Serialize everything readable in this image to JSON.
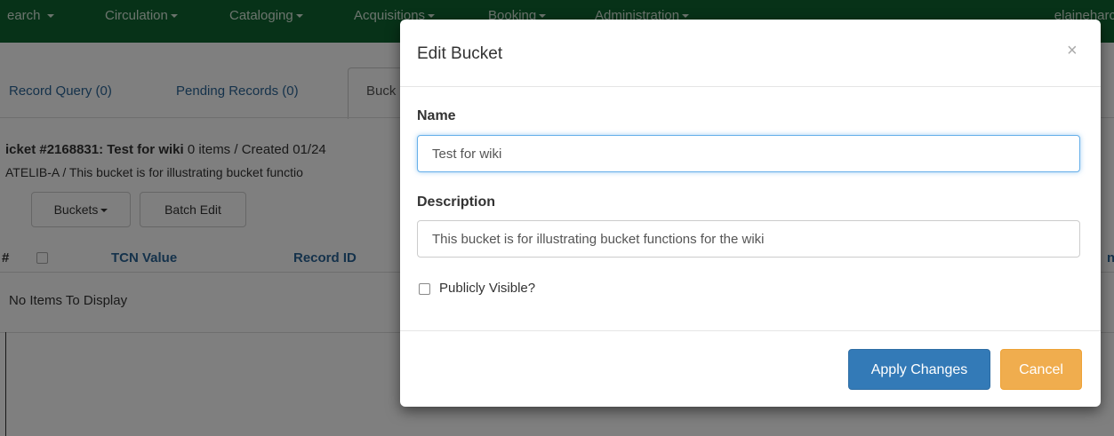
{
  "nav": {
    "items": [
      "earch",
      "Circulation",
      "Cataloging",
      "Acquisitions",
      "Booking",
      "Administration"
    ],
    "user": "elaineharc"
  },
  "page": {
    "tabs": [
      "Record Query (0)",
      "Pending Records (0)",
      "Buck"
    ],
    "bucket_title_bold": "icket #2168831: Test for wiki",
    "bucket_title_rest": " 0 items / Created 01/24",
    "bucket_line2": "ATELIB-A / This bucket is for illustrating bucket functio",
    "buttons": {
      "buckets": "Buckets",
      "batch_edit": "Batch Edit"
    },
    "grid": {
      "hash": "#",
      "col_tcn": "TCN Value",
      "col_record_id": "Record ID",
      "col_right": "n",
      "empty": "No Items To Display"
    }
  },
  "modal": {
    "title": "Edit Bucket",
    "close": "×",
    "name_label": "Name",
    "name_value": "Test for wiki",
    "description_label": "Description",
    "description_value": "This bucket is for illustrating bucket functions for the wiki",
    "public_label": "Publicly Visible?",
    "public_checked": false,
    "apply_label": "Apply Changes",
    "cancel_label": "Cancel"
  },
  "colors": {
    "navbar": "#0e6430",
    "primary": "#337ab7",
    "warning": "#f0ad4e",
    "link": "#2a6496"
  }
}
